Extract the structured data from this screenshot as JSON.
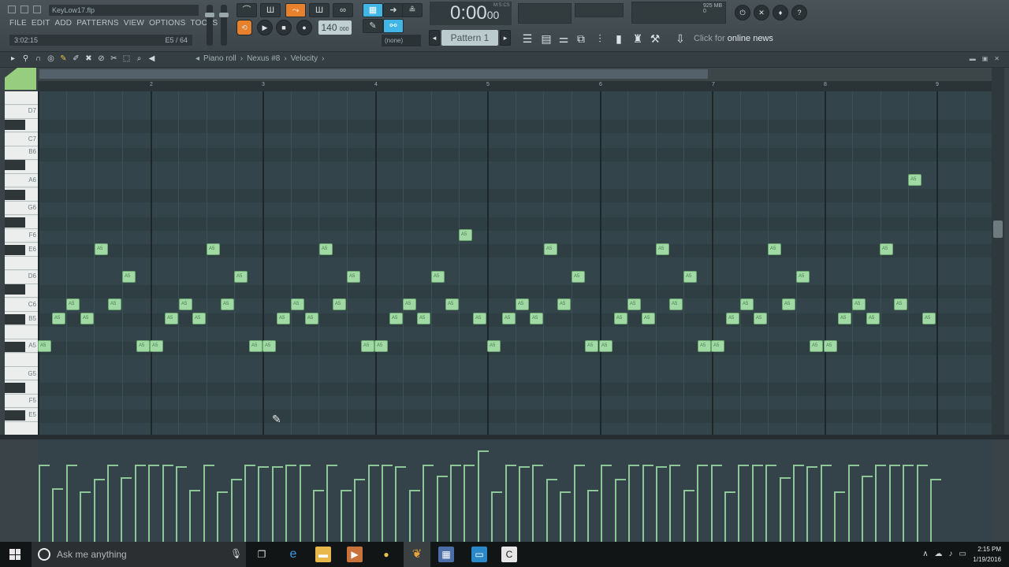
{
  "app": {
    "file_title": "KeyLow17.flp",
    "menus": [
      "FILE",
      "EDIT",
      "ADD",
      "PATTERNS",
      "VIEW",
      "OPTIONS",
      "TOOLS",
      "?"
    ],
    "hint_left": "3:02:15",
    "hint_right": "E5 / 64"
  },
  "transport": {
    "tempo": "140",
    "tempo_unit": "000",
    "time_main": "0:00",
    "time_sub": "00",
    "time_label": "M:S:CS",
    "pattern": "Pattern 1",
    "snap": "(none)",
    "memory": "925 MB",
    "cpu": "0"
  },
  "news": {
    "prefix": "Click for ",
    "highlight": "online news"
  },
  "piano_roll": {
    "crumbs": [
      "Piano roll",
      "›",
      "Nexus #8",
      "›",
      "Velocity",
      "›"
    ],
    "bars": [
      "2",
      "3",
      "4",
      "5",
      "6",
      "7",
      "8",
      "9"
    ],
    "key_labels": [
      "D7",
      "C7",
      "B6",
      "A6",
      "G6",
      "F6",
      "E6",
      "D6",
      "C6",
      "B5",
      "A5",
      "G5",
      "F5",
      "E5"
    ],
    "note_label": "A5"
  },
  "taskbar": {
    "search_placeholder": "Ask me anything",
    "time": "2:15 PM",
    "date": "1/19/2016"
  },
  "colors": {
    "note_fill": "#a1d9a4",
    "accent_orange": "#e7812d",
    "accent_blue": "#41b6e6",
    "grid_bg": "#33444a"
  }
}
